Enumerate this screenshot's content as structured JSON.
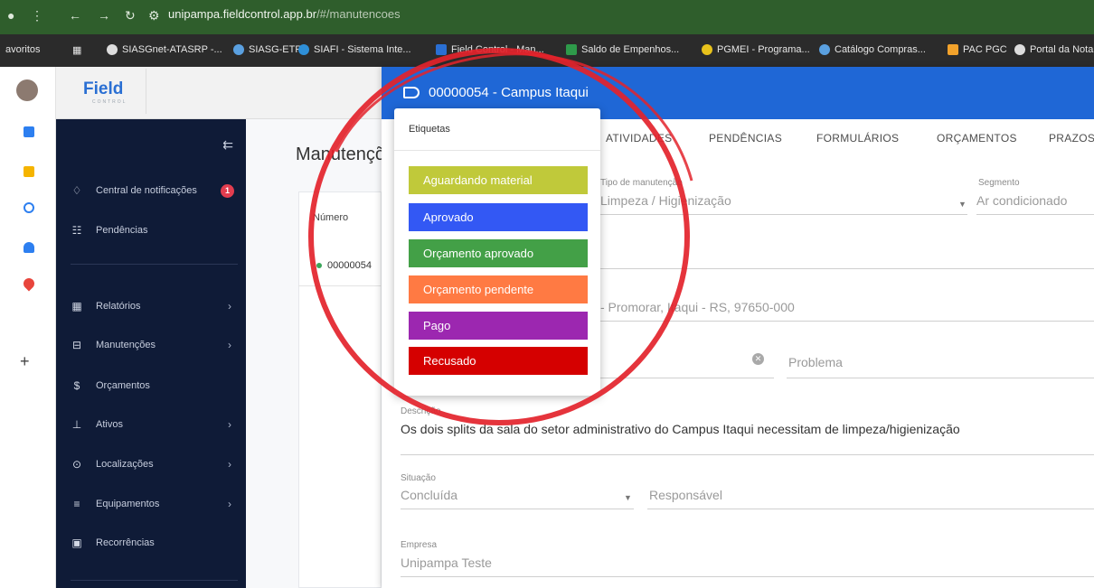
{
  "browser": {
    "url_host": "unipampa.fieldcontrol.app.br",
    "url_path": "/#/manutencoes",
    "bookmarks": [
      {
        "label": "avoritos"
      },
      {
        "label": "SIASGnet-ATASRP -..."
      },
      {
        "label": "SIASG-ETP"
      },
      {
        "label": "SIAFI - Sistema Inte..."
      },
      {
        "label": "Field Control - Man..."
      },
      {
        "label": "Saldo de Empenhos..."
      },
      {
        "label": "PGMEI - Programa..."
      },
      {
        "label": "Catálogo Compras..."
      },
      {
        "label": "PAC PGC"
      },
      {
        "label": "Portal da Nota"
      }
    ]
  },
  "app": {
    "logo": "Field",
    "logo_sub": "CONTROL",
    "page_title": "Manutenções",
    "table": {
      "col_number": "Número",
      "row_number": "00000054"
    }
  },
  "sidebar": {
    "items": [
      {
        "label": "Central de notificações",
        "icon": "bell-icon",
        "badge": "1"
      },
      {
        "label": "Pendências",
        "icon": "list-icon"
      },
      {
        "label": "Relatórios",
        "icon": "dashboard-icon"
      },
      {
        "label": "Manutenções",
        "icon": "briefcase-icon"
      },
      {
        "label": "Orçamentos",
        "icon": "dollar-icon"
      },
      {
        "label": "Ativos",
        "icon": "tree-icon"
      },
      {
        "label": "Localizações",
        "icon": "pin-icon"
      },
      {
        "label": "Equipamentos",
        "icon": "menu-icon"
      },
      {
        "label": "Recorrências",
        "icon": "calendar-icon"
      }
    ]
  },
  "panel": {
    "title": "00000054 - Campus Itaqui",
    "tabs": [
      "ATIVIDADES",
      "PENDÊNCIAS",
      "FORMULÁRIOS",
      "ORÇAMENTOS",
      "PRAZOS"
    ],
    "fields": {
      "tipo_label": "Tipo de manutenção",
      "tipo_value": "Limpeza / Higienização",
      "segmento_label": "Segmento",
      "segmento_value": "Ar condicionado",
      "endereco_value": "- Promorar, Itaqui - RS, 97650-000",
      "problema_placeholder": "Problema",
      "descricao_label": "Descrição",
      "descricao_value": "Os dois splits da sala do setor administrativo do Campus Itaqui necessitam de limpeza/higienização",
      "situacao_label": "Situação",
      "situacao_value": "Concluída",
      "responsavel_placeholder": "Responsável",
      "empresa_label": "Empresa",
      "empresa_value": "Unipampa Teste"
    }
  },
  "popup": {
    "title": "Etiquetas",
    "tags": [
      {
        "label": "Aguardando material",
        "color": "#c0c93a"
      },
      {
        "label": "Aprovado",
        "color": "#3358f4"
      },
      {
        "label": "Orçamento aprovado",
        "color": "#43a047"
      },
      {
        "label": "Orçamento pendente",
        "color": "#ff7a43"
      },
      {
        "label": "Pago",
        "color": "#9c27b0"
      },
      {
        "label": "Recusado",
        "color": "#d50000"
      }
    ]
  },
  "colors": {
    "header_blue": "#1f67d6",
    "sidebar_navy": "#0f1b37",
    "annotation_red": "#e3232b"
  }
}
